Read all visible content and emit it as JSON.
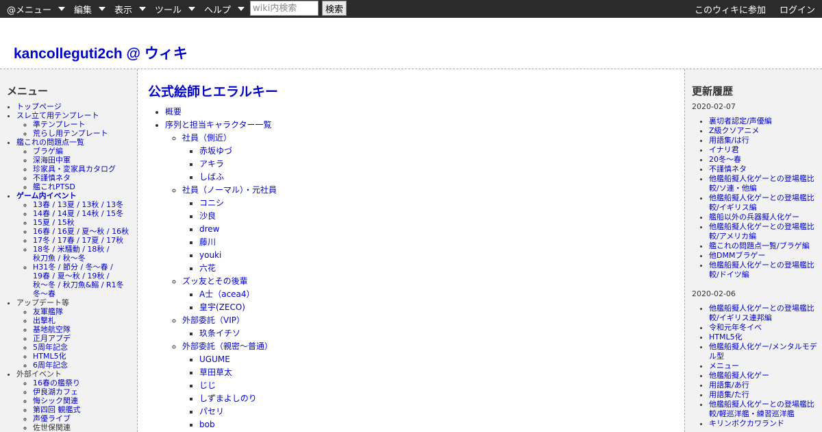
{
  "topbar": {
    "menus": [
      "@メニュー",
      "編集",
      "表示",
      "ツール",
      "ヘルプ"
    ],
    "search_placeholder": "wiki内検索",
    "search_button": "検索",
    "join": "このウィキに参加",
    "login": "ログイン"
  },
  "site": {
    "title": "kancolleguti2ch @ ウィキ"
  },
  "left": {
    "heading": "メニュー",
    "items": [
      "トップページ",
      "スレ立て用テンプレート",
      "準テンプレート",
      "荒らし用テンプレート",
      "艦これの問題点一覧",
      "ブラゲ編",
      "深海田中軍",
      "珍家具・変家具カタログ",
      "不謹慎ネタ",
      "艦これPTSD",
      "ゲーム内イベント",
      "13春 / 13夏 / 13秋 / 13冬",
      "14春 / 14夏 / 14秋 / 15冬",
      "15夏 / 15秋",
      "16春 / 16夏 / 夏～秋 / 16秋",
      "17冬 / 17春 / 17夏 / 17秋",
      "18冬 / 米騒動 / 18秋 /",
      "秋刀魚 / 秋〜冬",
      "H31冬 / 節分 / 冬〜春 /",
      "19春 / 夏〜秋 / 19秋 /",
      "秋～冬 / 秋刀魚&鰯 / R1冬",
      "冬〜春",
      "アップデート等",
      "友軍艦隊",
      "出撃札",
      "基地航空隊",
      "正月アプデ",
      "5周年記念",
      "HTML5化",
      "6周年記念",
      "外部イベント",
      "16春の艦祭り",
      "伊良湖カフェ",
      "悔シック関連",
      "第四回 観艦式",
      "声優ライブ",
      "佐世保関連"
    ]
  },
  "main": {
    "title": "公式絵師ヒエラルキー",
    "toc": [
      "概要",
      "序列と担当キャラクター一覧"
    ],
    "groups": [
      {
        "name": "社員（側近）",
        "members": [
          "赤坂ゆづ",
          "アキラ",
          "しばふ"
        ]
      },
      {
        "name": "社員（ノーマル）・元社員",
        "members": [
          "コニシ",
          "沙良",
          "drew",
          "藤川",
          "youki",
          "六花"
        ]
      },
      {
        "name": "ズッ友とその後輩",
        "members": [
          "A士（acea4）",
          "皇宇(ZECO)"
        ]
      },
      {
        "name": "外部委託（VIP）",
        "members": [
          "玖条イチソ"
        ]
      },
      {
        "name": "外部委託（親密～普通）",
        "members": [
          "UGUME",
          "草田草太",
          "じじ",
          "しずまよしのり",
          "パセリ",
          "bob"
        ]
      }
    ]
  },
  "right": {
    "heading": "更新履歴",
    "days": [
      {
        "date": "2020-02-07",
        "items": [
          "裏切者認定/声優編",
          "Z級クソアニメ",
          "用語集/は行",
          "イナリ君",
          "20冬〜春",
          "不謹慎ネタ",
          "他艦船擬人化ゲーとの登場艦比較/ソ連・他編",
          "他艦船擬人化ゲーとの登場艦比較/イギリス編",
          "艦船以外の兵器擬人化ゲー",
          "他艦船擬人化ゲーとの登場艦比較/アメリカ編",
          "艦これの問題点一覧/ブラゲ編",
          "他DMMブラゲー",
          "他艦船擬人化ゲーとの登場艦比較/ドイツ編"
        ]
      },
      {
        "date": "2020-02-06",
        "items": [
          "他艦船擬人化ゲーとの登場艦比較/イギリス連邦編",
          "令和元年冬イベ",
          "HTML5化",
          "他艦船擬人化ゲー/メンタルモデル型",
          "メニュー",
          "他艦船擬人化ゲー",
          "用語集/あ行",
          "用語集/た行",
          "他艦船擬人化ゲーとの登場艦比較/軽巡洋艦・練習巡洋艦",
          "キリンボクカワランド"
        ]
      }
    ]
  }
}
